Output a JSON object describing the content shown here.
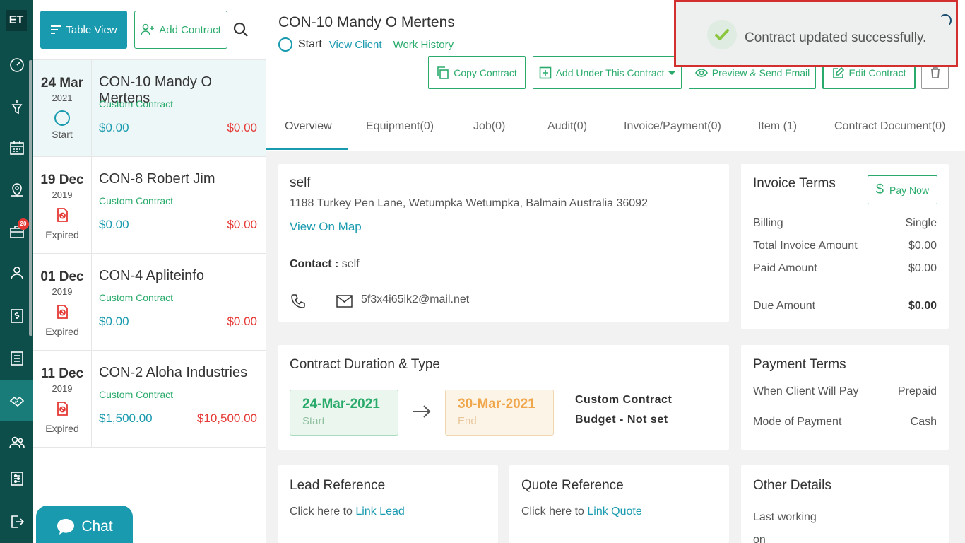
{
  "app": {
    "logo": "ET"
  },
  "rail": {
    "badge_count": "20",
    "icons": [
      "dashboard-icon",
      "funnel-icon",
      "calendar-icon",
      "map-pin-icon",
      "briefcase-icon",
      "user-icon",
      "dollar-icon",
      "list-icon",
      "handshake-icon",
      "users-icon",
      "sliders-icon",
      "logout-icon"
    ]
  },
  "list": {
    "table_view_label": "Table View",
    "add_contract_label": "Add Contract",
    "items": [
      {
        "day": "24 Mar",
        "year": "2021",
        "status": "Start",
        "name": "CON-10 Mandy O Mertens",
        "type": "Custom Contract",
        "amount1": "$0.00",
        "amount2": "$0.00"
      },
      {
        "day": "19 Dec",
        "year": "2019",
        "status": "Expired",
        "name": "CON-8 Robert Jim",
        "type": "Custom Contract",
        "amount1": "$0.00",
        "amount2": "$0.00"
      },
      {
        "day": "01 Dec",
        "year": "2019",
        "status": "Expired",
        "name": "CON-4 Apliteinfo",
        "type": "Custom Contract",
        "amount1": "$0.00",
        "amount2": "$0.00"
      },
      {
        "day": "11 Dec",
        "year": "2019",
        "status": "Expired",
        "name": "CON-2 Aloha Industries",
        "type": "Custom Contract",
        "amount1": "$1,500.00",
        "amount2": "$10,500.00"
      }
    ],
    "chat_label": "Chat"
  },
  "header": {
    "title": "CON-10 Mandy O Mertens",
    "status": "Start",
    "view_client": "View Client",
    "work_history": "Work History",
    "actions": {
      "copy": "Copy Contract",
      "add_under": "Add Under This Contract",
      "preview": "Preview & Send Email",
      "edit": "Edit Contract"
    },
    "tabs": [
      "Overview",
      "Equipment(0)",
      "Job(0)",
      "Audit(0)",
      "Invoice/Payment(0)",
      "Item (1)",
      "Contract Document(0)"
    ]
  },
  "client": {
    "name": "self",
    "address": "1188 Turkey Pen Lane, Wetumpka Wetumpka, Balmain Australia 36092",
    "view_on_map": "View On Map",
    "contact_label": "Contact :",
    "contact_value": "self",
    "email": "5f3x4i65ik2@mail.net"
  },
  "invoice_terms": {
    "title": "Invoice Terms",
    "pay_now": "Pay Now",
    "billing_label": "Billing",
    "billing_value": "Single",
    "total_label": "Total Invoice Amount",
    "total_value": "$0.00",
    "paid_label": "Paid Amount",
    "paid_value": "$0.00",
    "due_label": "Due Amount",
    "due_value": "$0.00"
  },
  "duration": {
    "title": "Contract Duration & Type",
    "start_date": "24-Mar-2021",
    "start_label": "Start",
    "end_date": "30-Mar-2021",
    "end_label": "End",
    "type_line": "Custom Contract",
    "budget_line": "Budget - Not set"
  },
  "payment_terms": {
    "title": "Payment Terms",
    "when_label": "When Client Will Pay",
    "when_value": "Prepaid",
    "mode_label": "Mode of Payment",
    "mode_value": "Cash"
  },
  "lead": {
    "title": "Lead Reference",
    "prefix": "Click here to",
    "link": "Link Lead"
  },
  "quote": {
    "title": "Quote Reference",
    "prefix": "Click here to",
    "link": "Link Quote"
  },
  "other": {
    "title": "Other Details",
    "line1": "Last working",
    "line2": "on"
  },
  "toast": {
    "message": "Contract updated successfully."
  },
  "colors": {
    "teal": "#1a9aaf",
    "green": "#2aab6b",
    "red": "#e53935",
    "rail": "#0d4d4a",
    "toast_border": "#d32f2f"
  }
}
